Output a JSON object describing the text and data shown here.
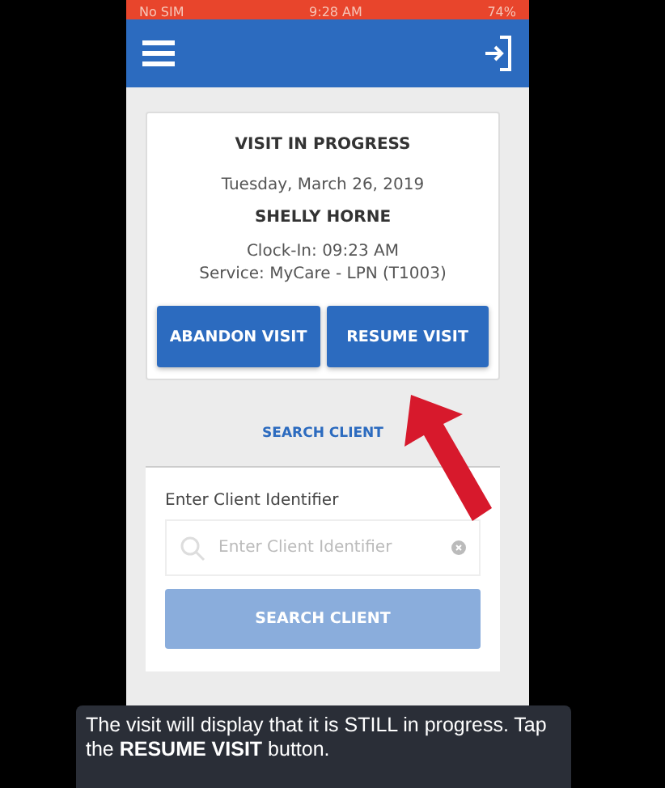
{
  "status_bar": {
    "carrier": "No SIM",
    "time": "9:28 AM",
    "battery": "74%"
  },
  "visit_card": {
    "title": "VISIT IN PROGRESS",
    "date": "Tuesday, March 26, 2019",
    "client_name": "SHELLY HORNE",
    "clock_in": "Clock-In: 09:23 AM",
    "service": "Service: MyCare - LPN (T1003)",
    "buttons": [
      "ABANDON VISIT",
      "RESUME VISIT"
    ]
  },
  "search_tab": {
    "label": "SEARCH CLIENT"
  },
  "search_card": {
    "field_label": "Enter Client Identifier",
    "placeholder": "Enter Client Identifier",
    "button": {
      "label": "SEARCH CLIENT",
      "disabled": true
    }
  },
  "caption": "The visit will display that it is STILL in progress. Tap the **RESUME VISIT** button."
}
